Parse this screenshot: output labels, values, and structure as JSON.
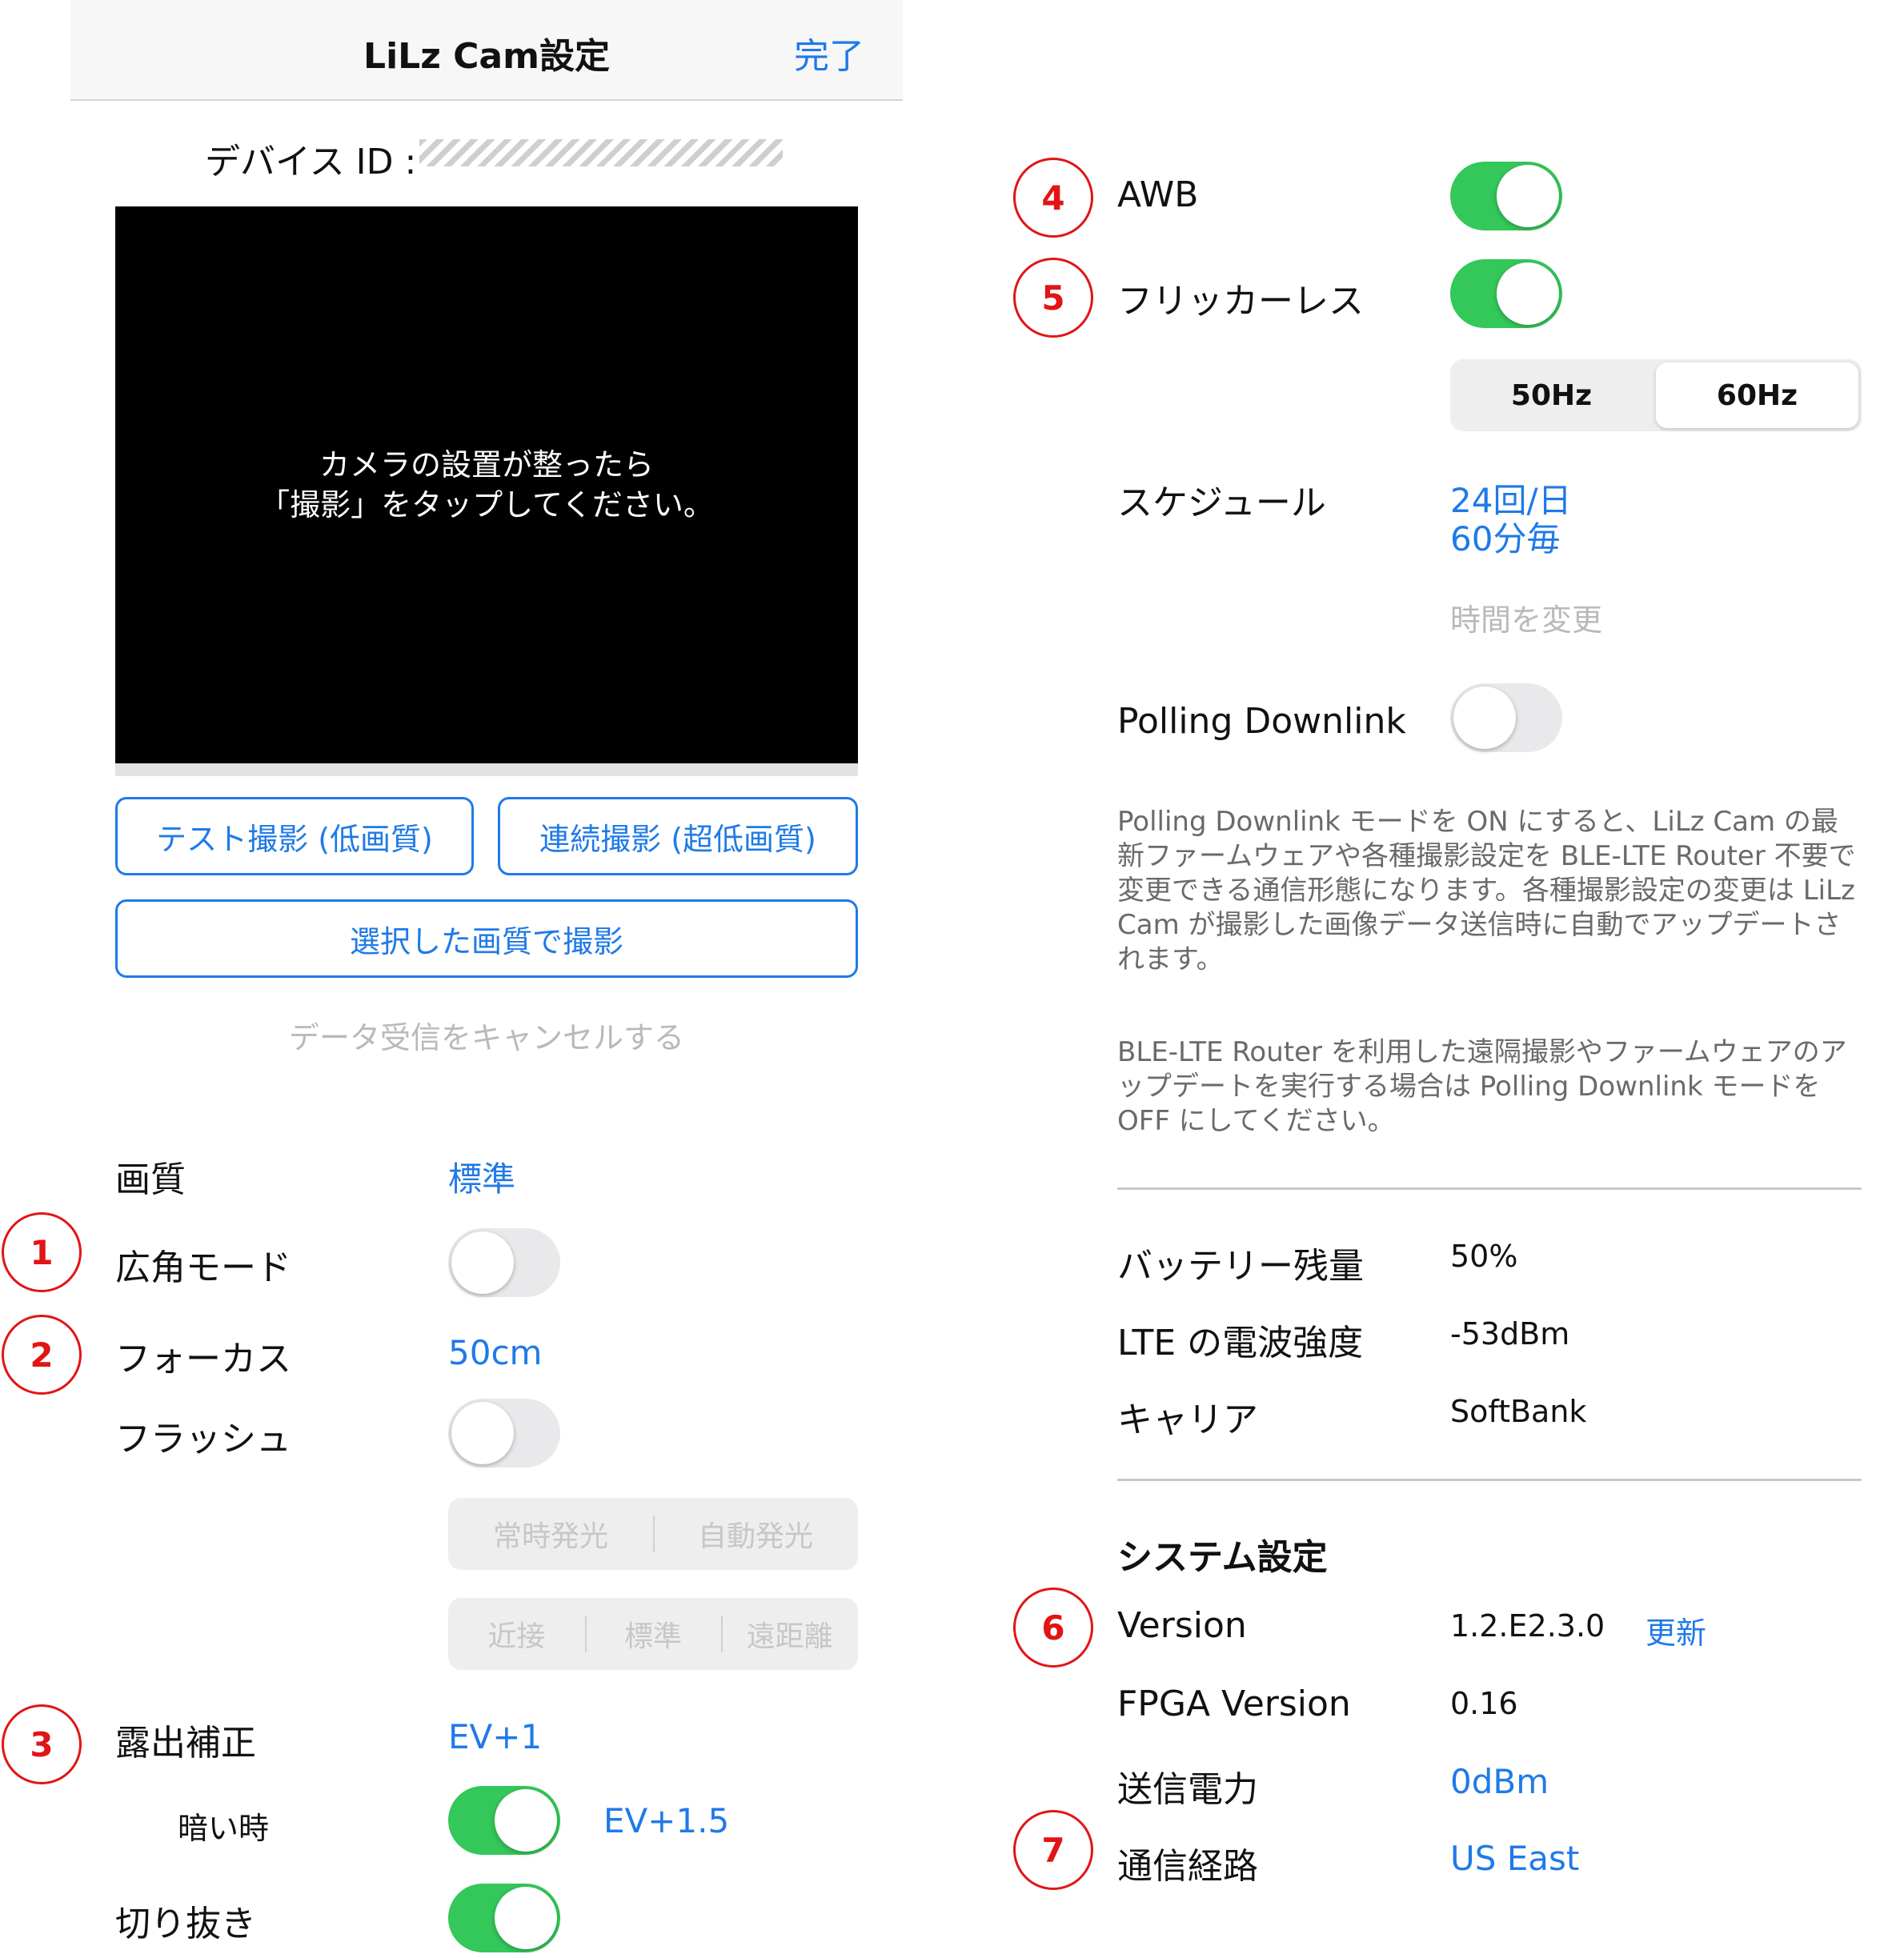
{
  "nav": {
    "title": "LiLz Cam設定",
    "done": "完了"
  },
  "device": {
    "id_label": "デバイス ID :"
  },
  "preview": {
    "message": "カメラの設置が整ったら\n「撮影」をタップしてください。"
  },
  "buttons": {
    "test_shot": "テスト撮影 (低画質)",
    "burst_shot": "連続撮影 (超低画質)",
    "selected_quality_shot": "選択した画質で撮影",
    "cancel_receive": "データ受信をキャンセルする"
  },
  "settings": {
    "quality": {
      "label": "画質",
      "value": "標準"
    },
    "wide_mode": {
      "label": "広角モード",
      "on": false
    },
    "focus": {
      "label": "フォーカス",
      "value": "50cm"
    },
    "flash": {
      "label": "フラッシュ",
      "on": false,
      "mode_options": [
        "常時発光",
        "自動発光"
      ],
      "distance_options": [
        "近接",
        "標準",
        "遠距離"
      ]
    },
    "exposure": {
      "label": "露出補正",
      "value": "EV+1",
      "dark_label": "暗い時",
      "dark_on": true,
      "dark_value": "EV+1.5"
    },
    "crop": {
      "label": "切り抜き",
      "on": true
    },
    "awb": {
      "label": "AWB",
      "on": true
    },
    "flickerless": {
      "label": "フリッカーレス",
      "on": true,
      "options": [
        "50Hz",
        "60Hz"
      ],
      "selected": "60Hz"
    },
    "schedule": {
      "label": "スケジュール",
      "value_line1": "24回/日",
      "value_line2": "60分毎",
      "change_time": "時間を変更"
    },
    "polling": {
      "label": "Polling Downlink",
      "on": false,
      "desc1": "Polling Downlink モードを ON にすると、LiLz Cam の最新ファームウェアや各種撮影設定を BLE-LTE Router 不要で変更できる通信形態になります。各種撮影設定の変更は LiLz Cam が撮影した画像データ送信時に自動でアップデートされます。",
      "desc2": "BLE-LTE Router を利用した遠隔撮影やファームウェアのアップデートを実行する場合は Polling Downlink モードを OFF にしてください。"
    }
  },
  "status": {
    "battery": {
      "label": "バッテリー残量",
      "value": "50%"
    },
    "lte": {
      "label": "LTE の電波強度",
      "value": "-53dBm"
    },
    "carrier": {
      "label": "キャリア",
      "value": "SoftBank"
    }
  },
  "system": {
    "heading": "システム設定",
    "version": {
      "label": "Version",
      "value": "1.2.E2.3.0",
      "update": "更新"
    },
    "fpga": {
      "label": "FPGA Version",
      "value": "0.16"
    },
    "tx_power": {
      "label": "送信電力",
      "value": "0dBm"
    },
    "route": {
      "label": "通信経路",
      "value": "US East"
    }
  },
  "markers": [
    "1",
    "2",
    "3",
    "4",
    "5",
    "6",
    "7"
  ],
  "colors": {
    "accent": "#1f7ae8",
    "toggle_on": "#34c759",
    "marker": "#e11515"
  }
}
